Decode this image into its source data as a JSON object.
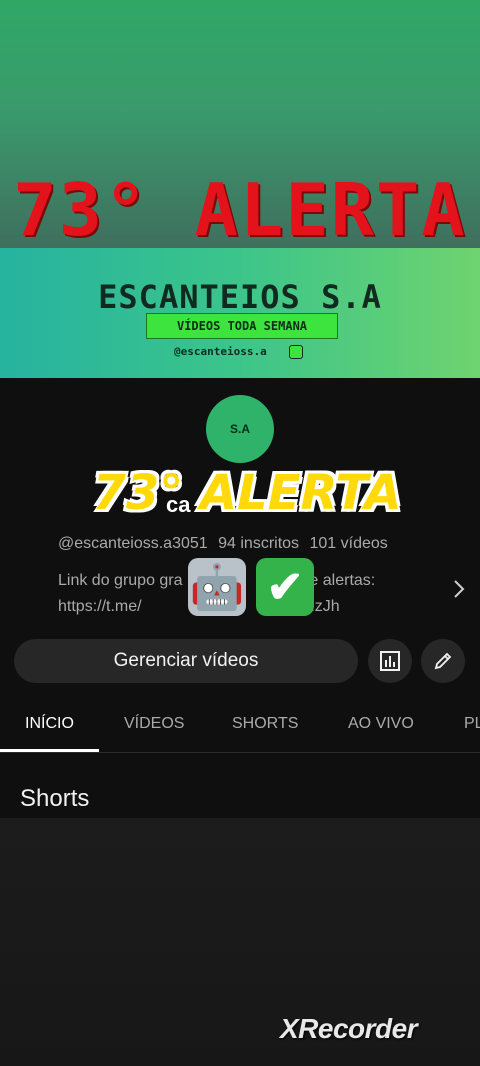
{
  "overlay": {
    "top_title": "73° ALERTA",
    "mid_title": "73° ALERTA"
  },
  "banner": {
    "title": "ESCANTEIOS S.A",
    "tagline": "VÍDEOS TODA SEMANA",
    "handle": "@escanteioss.a"
  },
  "avatar": {
    "text": "S.A"
  },
  "channel": {
    "name_fragment": "ca",
    "handle": "@escanteioss.a3051",
    "subscribers": "94 inscritos",
    "videos": "101 vídeos",
    "desc_line1_a": "Link do grupo gra",
    "desc_line1_b": "de alertas:",
    "desc_line2_a": "https://t.me/",
    "desc_line2_b": "wNzJh"
  },
  "actions": {
    "manage_label": "Gerenciar vídeos"
  },
  "tabs": [
    {
      "label": "INÍCIO"
    },
    {
      "label": "VÍDEOS"
    },
    {
      "label": "SHORTS"
    },
    {
      "label": "AO VIVO"
    },
    {
      "label": "PL"
    }
  ],
  "section": {
    "title": "Shorts"
  },
  "watermark": "XRecorder",
  "colors": {
    "alert_red": "#e3121b",
    "alert_yellow": "#ffd90a",
    "brand_green": "#3ee43e",
    "background": "#0f0f0f"
  },
  "icons": {
    "chevron": "chevron-right-icon",
    "analytics": "bar-chart-icon",
    "edit": "pencil-icon",
    "instagram": "instagram-icon"
  }
}
